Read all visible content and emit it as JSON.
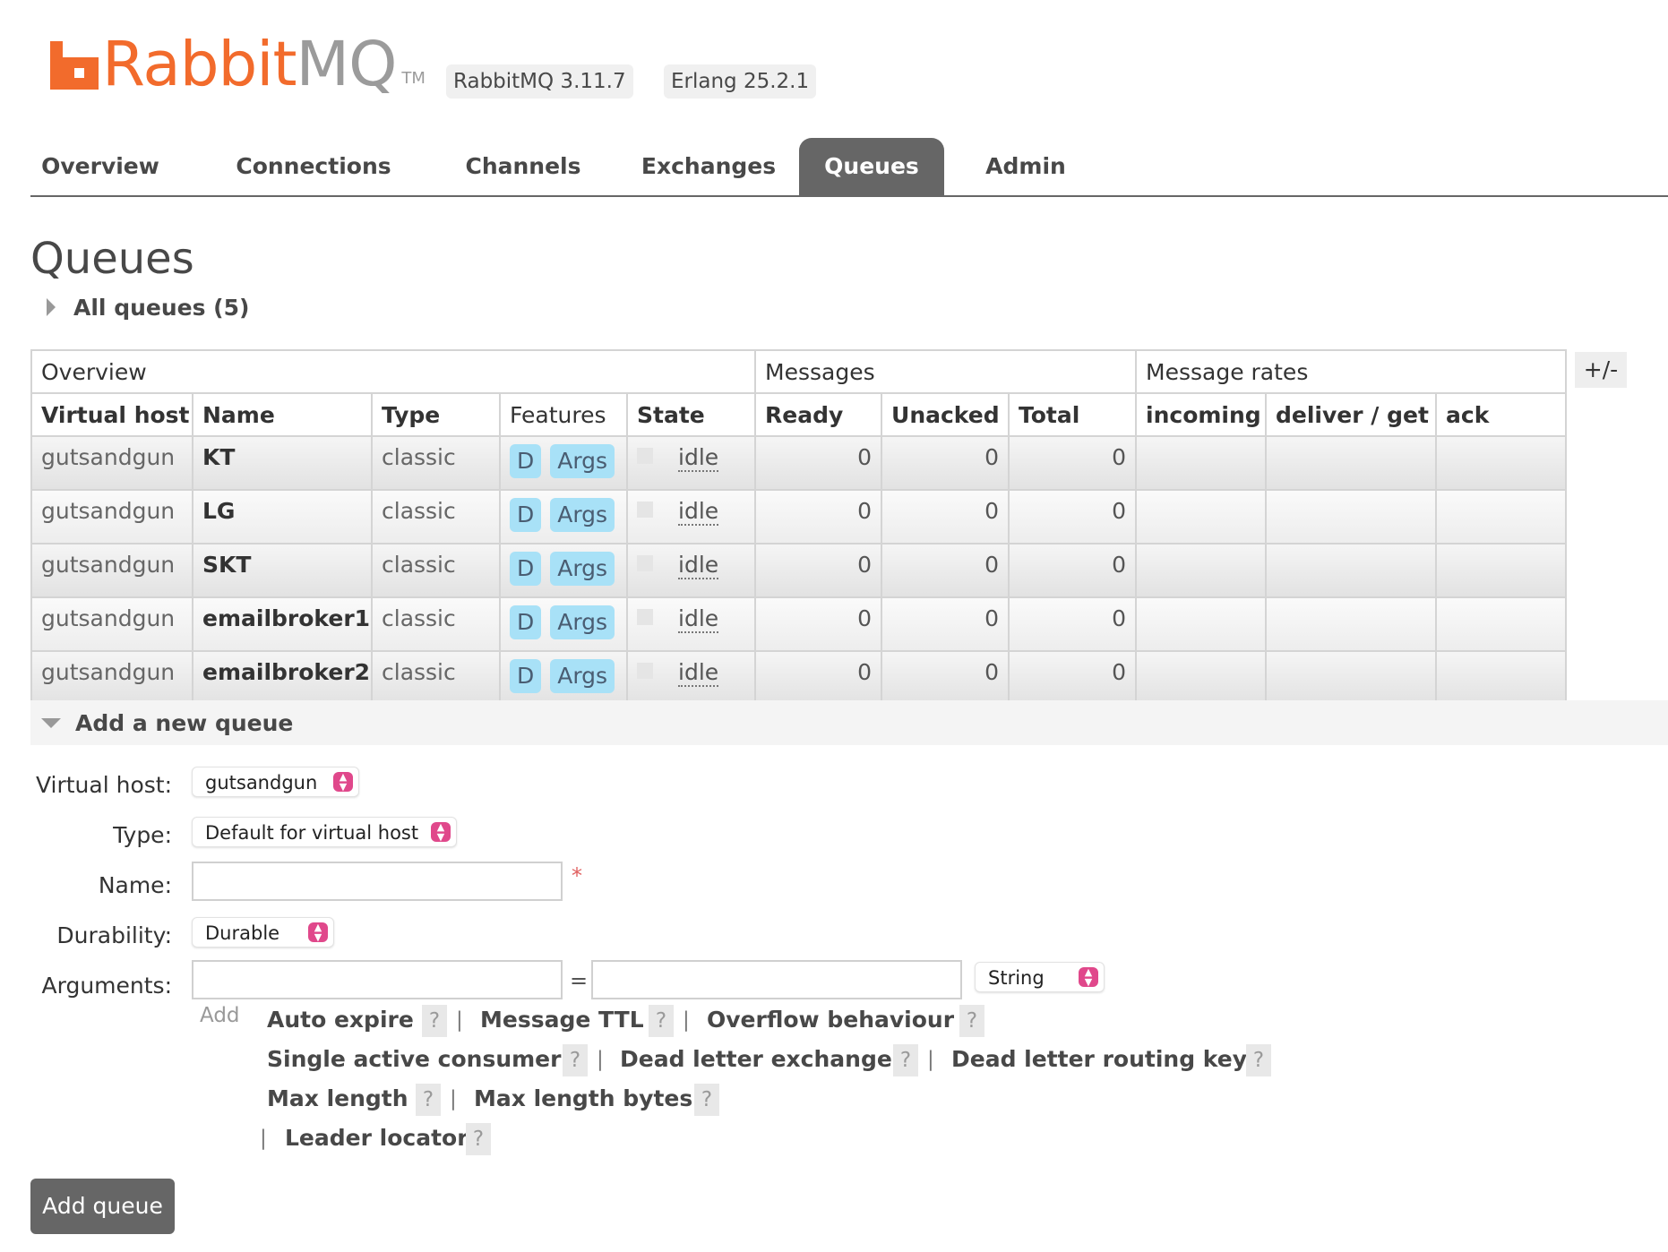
{
  "header": {
    "logo_rabbit": "Rabbit",
    "logo_mq": "MQ",
    "logo_tm": "TM",
    "rabbitmq_version": "RabbitMQ 3.11.7",
    "erlang_version": "Erlang 25.2.1"
  },
  "tabs": [
    {
      "label": "Overview",
      "active": false
    },
    {
      "label": "Connections",
      "active": false
    },
    {
      "label": "Channels",
      "active": false
    },
    {
      "label": "Exchanges",
      "active": false
    },
    {
      "label": "Queues",
      "active": true
    },
    {
      "label": "Admin",
      "active": false
    }
  ],
  "page": {
    "title": "Queues",
    "all_queues_label": "All queues (5)"
  },
  "table": {
    "groups": [
      "Overview",
      "Messages",
      "Message rates"
    ],
    "columns": [
      "Virtual host",
      "Name",
      "Type",
      "Features",
      "State",
      "Ready",
      "Unacked",
      "Total",
      "incoming",
      "deliver / get",
      "ack"
    ],
    "toggle_label": "+/-",
    "rows": [
      {
        "vhost": "gutsandgun",
        "name": "KT",
        "type": "classic",
        "feature_d": "D",
        "feature_args": "Args",
        "state": "idle",
        "ready": "0",
        "unacked": "0",
        "total": "0",
        "incoming": "",
        "deliver_get": "",
        "ack": ""
      },
      {
        "vhost": "gutsandgun",
        "name": "LG",
        "type": "classic",
        "feature_d": "D",
        "feature_args": "Args",
        "state": "idle",
        "ready": "0",
        "unacked": "0",
        "total": "0",
        "incoming": "",
        "deliver_get": "",
        "ack": ""
      },
      {
        "vhost": "gutsandgun",
        "name": "SKT",
        "type": "classic",
        "feature_d": "D",
        "feature_args": "Args",
        "state": "idle",
        "ready": "0",
        "unacked": "0",
        "total": "0",
        "incoming": "",
        "deliver_get": "",
        "ack": ""
      },
      {
        "vhost": "gutsandgun",
        "name": "emailbroker1",
        "type": "classic",
        "feature_d": "D",
        "feature_args": "Args",
        "state": "idle",
        "ready": "0",
        "unacked": "0",
        "total": "0",
        "incoming": "",
        "deliver_get": "",
        "ack": ""
      },
      {
        "vhost": "gutsandgun",
        "name": "emailbroker2",
        "type": "classic",
        "feature_d": "D",
        "feature_args": "Args",
        "state": "idle",
        "ready": "0",
        "unacked": "0",
        "total": "0",
        "incoming": "",
        "deliver_get": "",
        "ack": ""
      }
    ]
  },
  "add_queue": {
    "section_title": "Add a new queue",
    "labels": {
      "virtual_host": "Virtual host:",
      "type": "Type:",
      "name": "Name:",
      "durability": "Durability:",
      "arguments": "Arguments:"
    },
    "virtual_host_value": "gutsandgun",
    "type_value": "Default for virtual host",
    "name_value": "",
    "required_marker": "*",
    "durability_value": "Durable",
    "arg_key_value": "",
    "arg_equals": "=",
    "arg_value_value": "",
    "arg_type_value": "String",
    "add_label": "Add",
    "argument_links": [
      "Auto expire",
      "Message TTL",
      "Overflow behaviour",
      "Single active consumer",
      "Dead letter exchange",
      "Dead letter routing key",
      "Max length",
      "Max length bytes",
      "Leader locator"
    ],
    "help_marker": "?",
    "separator": "|",
    "submit_label": "Add queue"
  },
  "colors": {
    "brand_orange": "#f26b2c",
    "tab_active": "#666666",
    "feature_badge": "#a8e1f7",
    "select_accent": "#e0488b"
  }
}
